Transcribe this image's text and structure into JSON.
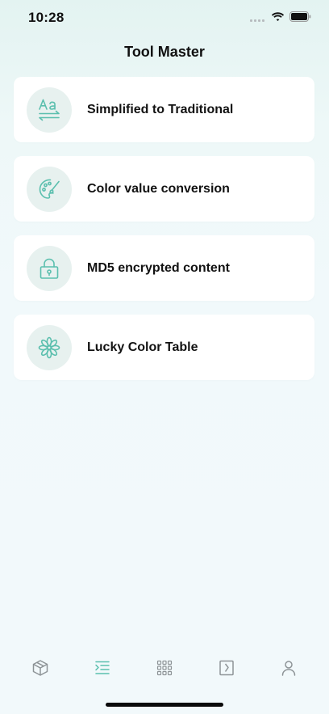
{
  "status_bar": {
    "time": "10:28"
  },
  "header": {
    "title": "Tool Master"
  },
  "tools": [
    {
      "label": "Simplified to Traditional",
      "icon": "text-convert-icon"
    },
    {
      "label": "Color value conversion",
      "icon": "palette-icon"
    },
    {
      "label": "MD5 encrypted content",
      "icon": "lock-icon"
    },
    {
      "label": "Lucky Color Table",
      "icon": "flower-icon"
    }
  ],
  "tab_bar": {
    "items": [
      {
        "icon": "cube-icon",
        "selected": false
      },
      {
        "icon": "list-indent-icon",
        "selected": true
      },
      {
        "icon": "grid-icon",
        "selected": false
      },
      {
        "icon": "note-icon",
        "selected": false
      },
      {
        "icon": "person-icon",
        "selected": false
      }
    ]
  },
  "colors": {
    "accent": "#5bbfae",
    "inactive_icon": "#8e9497",
    "icon_circle": "#e7f1ef",
    "card": "#ffffff"
  }
}
